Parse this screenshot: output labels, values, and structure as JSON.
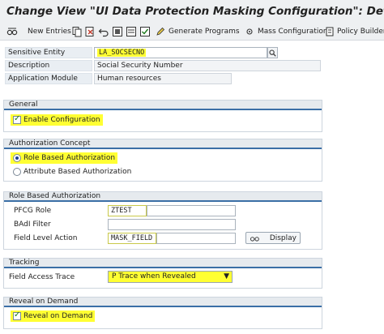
{
  "window": {
    "title": "Change View \"UI Data Protection Masking Configuration\": Details"
  },
  "toolbar": {
    "new_entries": "New Entries",
    "generate_programs": "Generate Programs",
    "mass_configuration": "Mass Configuration",
    "policy_builder": "Policy Builder"
  },
  "header_fields": {
    "sensitive_entity_label": "Sensitive Entity",
    "sensitive_entity_value": "LA_SOCSECNO",
    "description_label": "Description",
    "description_value": "Social Security Number",
    "application_module_label": "Application Module",
    "application_module_value": "Human resources"
  },
  "general": {
    "title": "General",
    "enable_configuration_label": "Enable Configuration",
    "enable_configuration_checked": true
  },
  "authorization_concept": {
    "title": "Authorization Concept",
    "role_based_label": "Role Based Authorization",
    "attribute_based_label": "Attribute Based Authorization",
    "selected": "Role Based Authorization"
  },
  "role_based_authorization": {
    "title": "Role Based Authorization",
    "pfcg_role_label": "PFCG Role",
    "pfcg_role_value": "ZTEST",
    "badi_filter_label": "BAdI Filter",
    "badi_filter_value": "",
    "field_level_action_label": "Field Level Action",
    "field_level_action_value": "MASK_FIELD",
    "display_button": "Display"
  },
  "tracking": {
    "title": "Tracking",
    "field_access_trace_label": "Field Access Trace",
    "field_access_trace_value": "P Trace when Revealed"
  },
  "reveal_on_demand": {
    "title": "Reveal on Demand",
    "reveal_label": "Reveal on Demand",
    "reveal_checked": true
  },
  "colors": {
    "highlight": "#ffff33",
    "section_rule": "#3b6fa6",
    "toolbar_bg": "#eef0f2"
  }
}
